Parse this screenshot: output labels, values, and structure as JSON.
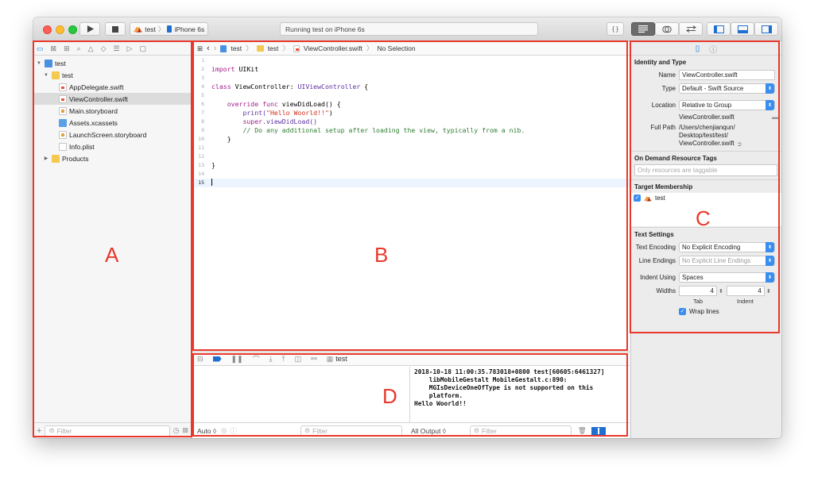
{
  "toolbar": {
    "scheme_target": "test",
    "scheme_device": "iPhone 6s",
    "activity_status": "Running test on iPhone 6s",
    "code_braces": "{ }"
  },
  "navigator": {
    "tab_icons": [
      "folder-icon",
      "source-control-icon",
      "symbol-icon",
      "search-icon",
      "warning-icon",
      "test-icon",
      "debug-icon",
      "breakpoint-icon",
      "report-icon"
    ],
    "tree": {
      "project": "test",
      "group": "test",
      "files": [
        "AppDelegate.swift",
        "ViewController.swift",
        "Main.storyboard",
        "Assets.xcassets",
        "LaunchScreen.storyboard",
        "Info.plist"
      ],
      "products": "Products"
    },
    "filter_placeholder": "Filter"
  },
  "editor": {
    "jumpbar": {
      "project": "test",
      "group": "test",
      "file": "ViewController.swift",
      "selection": "No Selection"
    },
    "line_numbers": [
      "1",
      "2",
      "3",
      "4",
      "5",
      "6",
      "7",
      "8",
      "9",
      "10",
      "11",
      "12",
      "13",
      "14",
      "15"
    ],
    "code": {
      "l2_kw": "import",
      "l2_rest": " UIKit",
      "l4_kw": "class",
      "l4_mid": " ViewController: ",
      "l4_type": "UIViewController",
      "l4_end": " {",
      "l6_kw1": "override",
      "l6_mid": " ",
      "l6_kw2": "func",
      "l6_end": " viewDidLoad() {",
      "l7_fn": "print(",
      "l7_str": "\"Hello Woorld!!\"",
      "l7_end": ")",
      "l8_kw": "super",
      "l8_end": ".viewDidLoad()",
      "l9_comment": "// Do any additional setup after loading the view, typically from a nib.",
      "l10": "}",
      "l13": "}"
    }
  },
  "debug": {
    "scheme": "test",
    "console_output": "2018-10-18 11:00:35.783018+0800 test[60605:6461327]\n    libMobileGestalt MobileGestalt.c:890:\n    MGIsDeviceOneOfType is not supported on this\n    platform.\nHello Woorld!!",
    "var_scope": "Auto",
    "var_filter_placeholder": "Filter",
    "output_selector": "All Output",
    "console_filter_placeholder": "Filter"
  },
  "inspector": {
    "identity_title": "Identity and Type",
    "name_label": "Name",
    "name_value": "ViewController.swift",
    "type_label": "Type",
    "type_value": "Default - Swift Source",
    "location_label": "Location",
    "location_value": "Relative to Group",
    "location_file": "ViewController.swift",
    "fullpath_label": "Full Path",
    "fullpath_value": "/Users/chenjianqun/\nDesktop/test/test/\nViewController.swift",
    "odr_title": "On Demand Resource Tags",
    "odr_placeholder": "Only resources are taggable",
    "membership_title": "Target Membership",
    "membership_target": "test",
    "text_settings_title": "Text Settings",
    "encoding_label": "Text Encoding",
    "encoding_value": "No Explicit Encoding",
    "line_endings_label": "Line Endings",
    "line_endings_value": "No Explicit Line Endings",
    "indent_using_label": "Indent Using",
    "indent_using_value": "Spaces",
    "widths_label": "Widths",
    "tab_width": "4",
    "indent_width": "4",
    "tab_caption": "Tab",
    "indent_caption": "Indent",
    "wrap_lines": "Wrap lines"
  },
  "annotations": {
    "a": "A",
    "b": "B",
    "c": "C",
    "d": "D"
  },
  "colors": {
    "annotation_red": "#e8382c",
    "accent_blue": "#1679e5",
    "keyword": "#a0208c",
    "string": "#d12f1b",
    "comment": "#2e7d32"
  }
}
